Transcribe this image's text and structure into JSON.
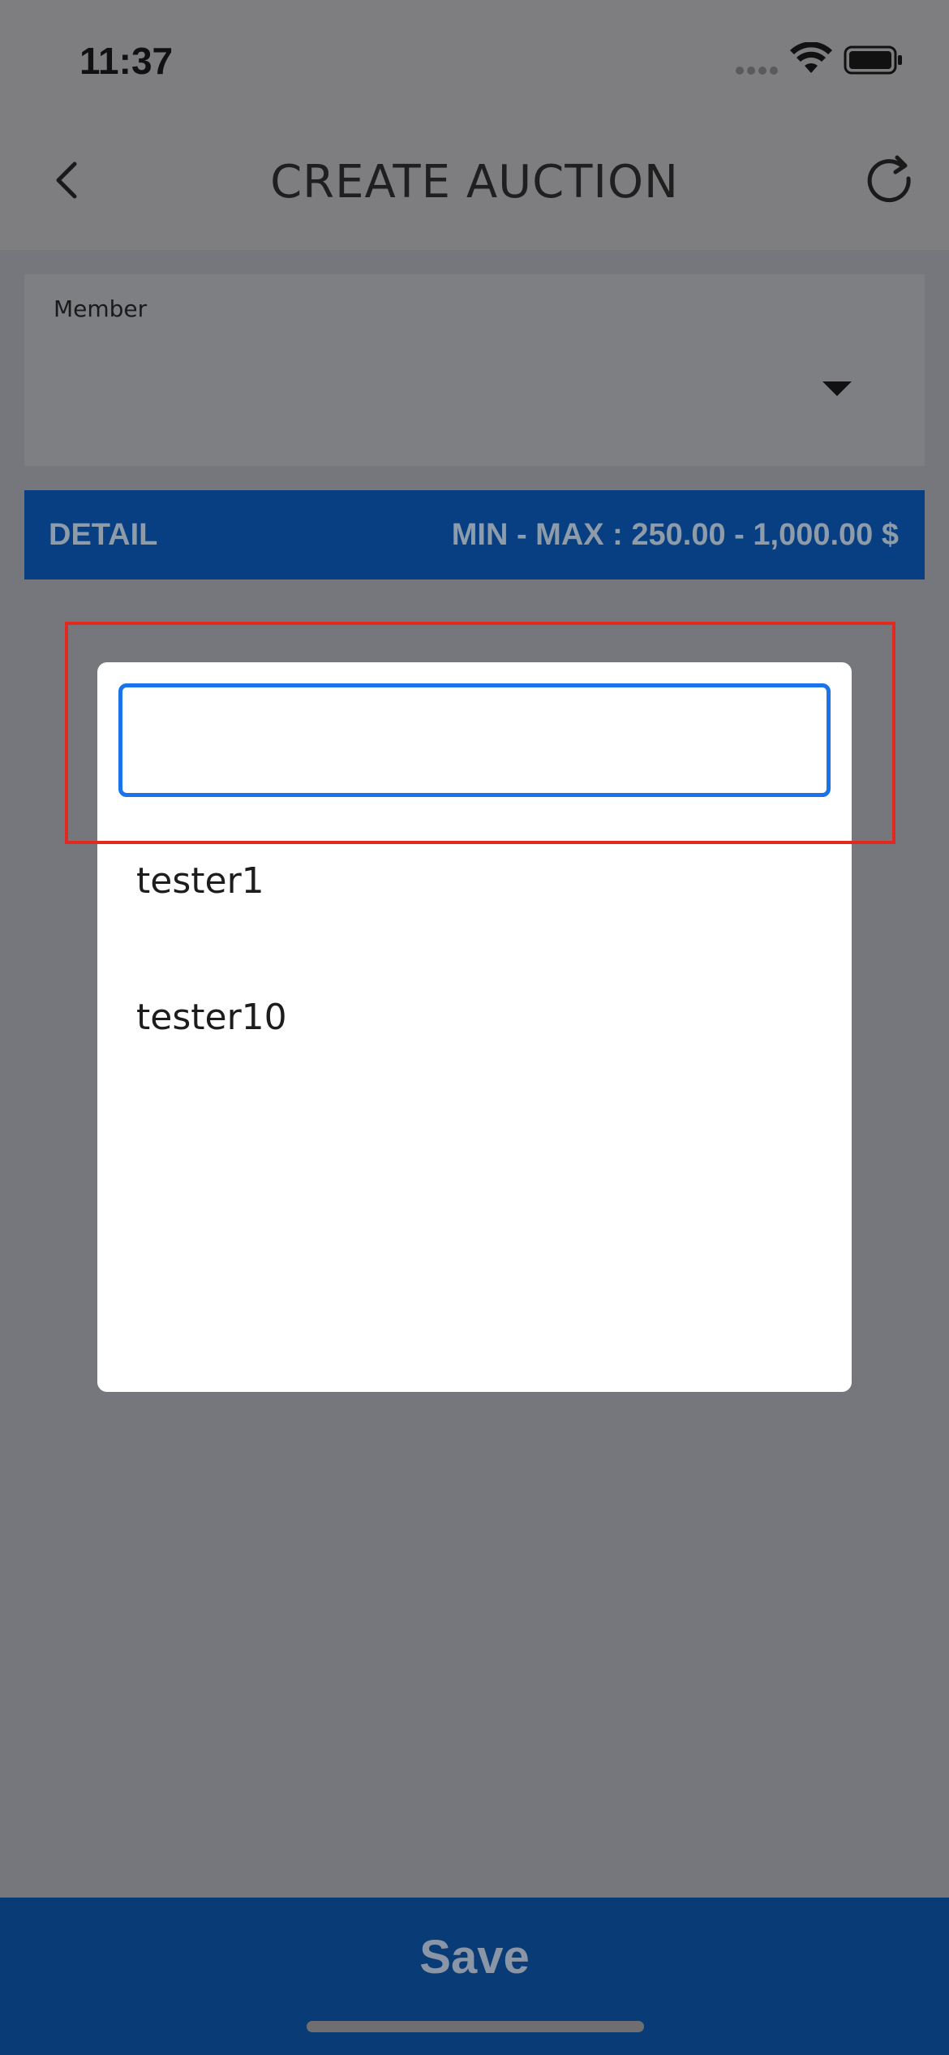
{
  "status_bar": {
    "time": "11:37"
  },
  "header": {
    "title": "CREATE AUCTION"
  },
  "member_field": {
    "label": "Member"
  },
  "detail_bar": {
    "label": "DETAIL",
    "range": "MIN - MAX : 250.00 - 1,000.00 $"
  },
  "dialog": {
    "search_value": "",
    "options": [
      {
        "label": "tester1"
      },
      {
        "label": "tester10"
      }
    ]
  },
  "footer": {
    "save_label": "Save"
  },
  "colors": {
    "overlay_background": "#7a7b80",
    "detail_bar": "#083f83",
    "save_bar": "#093c77",
    "input_border": "#1a73e8",
    "highlight": "#e2291f"
  }
}
